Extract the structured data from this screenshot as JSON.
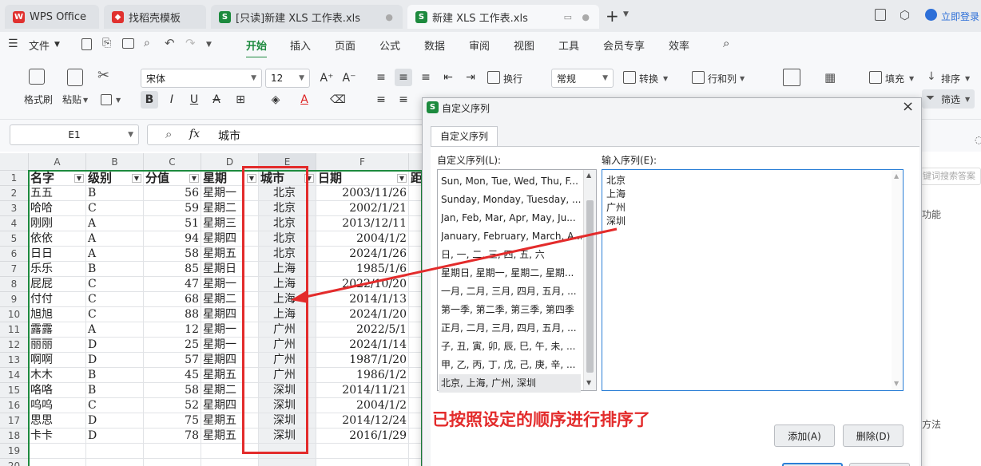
{
  "tabs": [
    {
      "label": "WPS Office"
    },
    {
      "label": "找稻壳模板"
    },
    {
      "label": "[只读]新建 XLS 工作表.xls"
    },
    {
      "label": "新建 XLS 工作表.xls"
    }
  ],
  "tabbar": {
    "add": "+",
    "login": "立即登录"
  },
  "menu": {
    "file": "文件",
    "items": [
      "开始",
      "插入",
      "页面",
      "公式",
      "数据",
      "审阅",
      "视图",
      "工具",
      "会员专享",
      "效率"
    ]
  },
  "ribbon": {
    "format_painter": "格式刷",
    "paste": "粘贴",
    "font_name": "宋体",
    "font_size": "12",
    "wrap": "换行",
    "number_format": "常规",
    "convert": "转换",
    "rows_cols": "行和列",
    "fill": "填充",
    "sort": "排序",
    "filter": "筛选"
  },
  "formula": {
    "name_box": "E1",
    "fx": "fx",
    "value": "城市"
  },
  "grid": {
    "columns": [
      "A",
      "B",
      "C",
      "D",
      "E",
      "F"
    ],
    "header": [
      "名字",
      "级别",
      "分值",
      "星期",
      "城市",
      "日期",
      "距"
    ],
    "rows": [
      [
        "五五",
        "B",
        "56",
        "星期一",
        "北京",
        "2003/11/26"
      ],
      [
        "哈哈",
        "C",
        "59",
        "星期二",
        "北京",
        "2002/1/21"
      ],
      [
        "刚刚",
        "A",
        "51",
        "星期三",
        "北京",
        "2013/12/11"
      ],
      [
        "依依",
        "A",
        "94",
        "星期四",
        "北京",
        "2004/1/2"
      ],
      [
        "日日",
        "A",
        "58",
        "星期五",
        "北京",
        "2024/1/26"
      ],
      [
        "乐乐",
        "B",
        "85",
        "星期日",
        "上海",
        "1985/1/6"
      ],
      [
        "屁屁",
        "C",
        "47",
        "星期一",
        "上海",
        "2022/10/20"
      ],
      [
        "付付",
        "C",
        "68",
        "星期二",
        "上海",
        "2014/1/13"
      ],
      [
        "旭旭",
        "C",
        "88",
        "星期四",
        "上海",
        "2024/1/20"
      ],
      [
        "露露",
        "A",
        "12",
        "星期一",
        "广州",
        "2022/5/1"
      ],
      [
        "丽丽",
        "D",
        "25",
        "星期一",
        "广州",
        "2024/1/14"
      ],
      [
        "啊啊",
        "D",
        "57",
        "星期四",
        "广州",
        "1987/1/20"
      ],
      [
        "木木",
        "B",
        "45",
        "星期五",
        "广州",
        "1986/1/2"
      ],
      [
        "咯咯",
        "B",
        "58",
        "星期二",
        "深圳",
        "2014/11/21"
      ],
      [
        "呜呜",
        "C",
        "52",
        "星期四",
        "深圳",
        "2004/1/2"
      ],
      [
        "思思",
        "D",
        "75",
        "星期五",
        "深圳",
        "2014/12/24"
      ],
      [
        "卡卡",
        "D",
        "78",
        "星期五",
        "深圳",
        "2016/1/29"
      ]
    ],
    "row_numbers": [
      "1",
      "2",
      "3",
      "4",
      "5",
      "6",
      "7",
      "8",
      "9",
      "10",
      "11",
      "12",
      "13",
      "14",
      "15",
      "16",
      "17",
      "18",
      "19",
      "20"
    ]
  },
  "dialog": {
    "title": "自定义序列",
    "tab": "自定义序列",
    "list_label": "自定义序列(L):",
    "input_label": "输入序列(E):",
    "list_items": [
      "Sun, Mon, Tue, Wed, Thu, F...",
      "Sunday, Monday, Tuesday, ...",
      "Jan, Feb, Mar, Apr, May, Ju...",
      "January, February, March, A...",
      "日, 一, 二, 三, 四, 五, 六",
      "星期日, 星期一, 星期二, 星期...",
      "一月, 二月, 三月, 四月, 五月, ...",
      "第一季, 第二季, 第三季, 第四季",
      "正月, 二月, 三月, 四月, 五月, ...",
      "子, 丑, 寅, 卯, 辰, 巳, 午, 未, ...",
      "甲, 乙, 丙, 丁, 戊, 己, 庚, 辛, ...",
      "北京, 上海, 广州, 深圳"
    ],
    "input_lines": [
      "北京",
      "上海",
      "广州",
      "深圳"
    ],
    "add_button": "添加(A)",
    "delete_button": "删除(D)"
  },
  "annotation": "已按照设定的顺序进行排序了",
  "right_panel": {
    "search_placeholder": "键词搜索答案",
    "func": "功能",
    "method": "方法"
  }
}
